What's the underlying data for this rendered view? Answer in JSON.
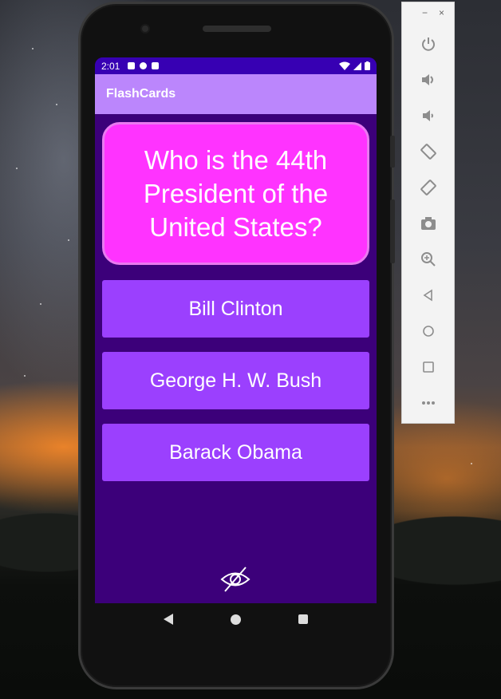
{
  "app": {
    "title": "FlashCards",
    "status_time": "2:01"
  },
  "question": {
    "text": "Who is the 44th President of the United States?"
  },
  "answers": [
    {
      "label": "Bill Clinton"
    },
    {
      "label": "George H. W. Bush"
    },
    {
      "label": "Barack Obama"
    }
  ],
  "colors": {
    "status_bar": "#3700b3",
    "app_bar": "#bb86fc",
    "background": "#3c007a",
    "question_card": "#ff33ff",
    "answer_button": "#9b40fe"
  },
  "icons": {
    "toggle": "eye-slash-icon",
    "nav_back": "back-triangle-icon",
    "nav_home": "home-circle-icon",
    "nav_recents": "recents-square-icon"
  },
  "emulator_toolbar": {
    "window_controls": [
      "−",
      "×"
    ],
    "buttons": [
      "power-icon",
      "volume-up-icon",
      "volume-down-icon",
      "rotate-left-icon",
      "rotate-right-icon",
      "camera-icon",
      "zoom-icon",
      "back-icon",
      "home-icon",
      "overview-icon",
      "more-icon"
    ]
  }
}
